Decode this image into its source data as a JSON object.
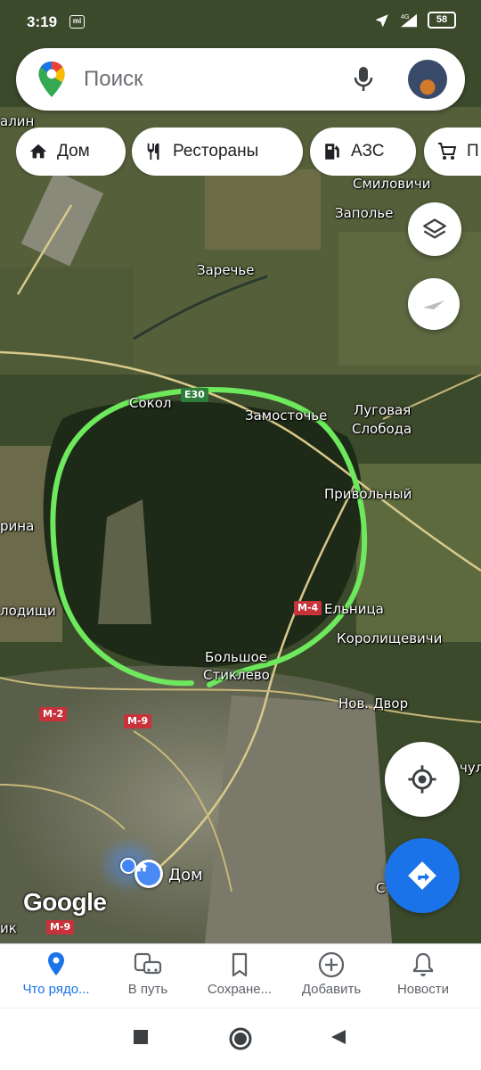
{
  "status_bar": {
    "time": "3:19",
    "battery": "58"
  },
  "search": {
    "placeholder": "Поиск"
  },
  "chips": [
    {
      "label": "Дом",
      "icon": "home-icon"
    },
    {
      "label": "Рестораны",
      "icon": "restaurant-icon"
    },
    {
      "label": "АЗС",
      "icon": "gas-station-icon"
    },
    {
      "label": "П",
      "icon": "shopping-cart-icon"
    }
  ],
  "map": {
    "places": [
      {
        "name": "Смиловичи"
      },
      {
        "name": "Заполье"
      },
      {
        "name": "Заречье"
      },
      {
        "name": "Сокол"
      },
      {
        "name": "Замосточье"
      },
      {
        "name": "Луговая"
      },
      {
        "name": "Слобода"
      },
      {
        "name": "Привольный"
      },
      {
        "name": "рина"
      },
      {
        "name": "лодищи"
      },
      {
        "name": "Ельница"
      },
      {
        "name": "Королищевичи"
      },
      {
        "name": "Большое"
      },
      {
        "name": "Стиклево"
      },
      {
        "name": "Нов. Двор"
      },
      {
        "name": "алин"
      },
      {
        "name": "ик"
      },
      {
        "name": "чул"
      },
      {
        "name": "С"
      }
    ],
    "road_labels": [
      "E30",
      "M-4",
      "M-2",
      "M-9",
      "M-9"
    ],
    "home_label": "Дом",
    "attribution": "Google",
    "annotation_color": "#6ee85c"
  },
  "bottom_nav": [
    {
      "label": "Что рядо...",
      "icon": "explore-pin-icon",
      "active": true
    },
    {
      "label": "В путь",
      "icon": "commute-icon",
      "active": false
    },
    {
      "label": "Сохране...",
      "icon": "bookmark-icon",
      "active": false
    },
    {
      "label": "Добавить",
      "icon": "add-circle-icon",
      "active": false
    },
    {
      "label": "Новости",
      "icon": "bell-icon",
      "active": false
    }
  ],
  "colors": {
    "accent": "#1a73e8"
  }
}
